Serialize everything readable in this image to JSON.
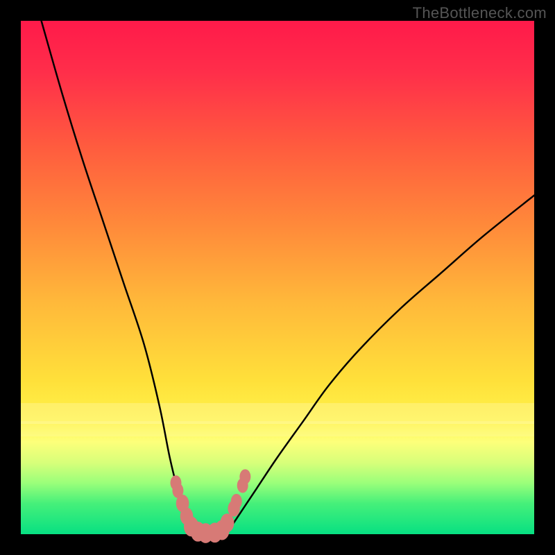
{
  "attribution": "TheBottleneck.com",
  "colors": {
    "gradient_top": "#ff1a4a",
    "gradient_mid": "#ffe03a",
    "gradient_bottom": "#07e082",
    "curve": "#000000",
    "markers": "#d77a76",
    "frame": "#000000"
  },
  "chart_data": {
    "type": "line",
    "title": "",
    "xlabel": "",
    "ylabel": "",
    "xlim": [
      0,
      100
    ],
    "ylim": [
      0,
      100
    ],
    "grid": false,
    "legend": false,
    "notes": "V-shaped bottleneck curve over gradient background. Minimum reaches 0 around x=33–40. Lower y = better (green band at bottom).",
    "series": [
      {
        "name": "left-branch",
        "x": [
          4,
          8,
          12,
          16,
          20,
          24,
          27,
          29,
          30.5,
          32,
          33,
          34
        ],
        "values": [
          100,
          86,
          73,
          61,
          49,
          37,
          25,
          15,
          9,
          5,
          2,
          0
        ]
      },
      {
        "name": "right-branch",
        "x": [
          40,
          42,
          44,
          46,
          50,
          55,
          60,
          66,
          74,
          82,
          90,
          100
        ],
        "values": [
          0,
          3,
          6,
          9,
          15,
          22,
          29,
          36,
          44,
          51,
          58,
          66
        ]
      },
      {
        "name": "valley-floor",
        "x": [
          34,
          36,
          38,
          40
        ],
        "values": [
          0,
          0,
          0,
          0
        ]
      }
    ],
    "markers": [
      {
        "x": 30.2,
        "y": 10,
        "r": 1.2
      },
      {
        "x": 30.6,
        "y": 8.5,
        "r": 1.2
      },
      {
        "x": 31.5,
        "y": 6,
        "r": 1.4
      },
      {
        "x": 32.3,
        "y": 3.5,
        "r": 1.4
      },
      {
        "x": 33.2,
        "y": 1.5,
        "r": 1.6
      },
      {
        "x": 34.5,
        "y": 0.5,
        "r": 1.6
      },
      {
        "x": 36,
        "y": 0.2,
        "r": 1.6
      },
      {
        "x": 37.8,
        "y": 0.3,
        "r": 1.6
      },
      {
        "x": 39.2,
        "y": 0.8,
        "r": 1.6
      },
      {
        "x": 40.2,
        "y": 2.2,
        "r": 1.5
      },
      {
        "x": 41.5,
        "y": 5,
        "r": 1.3
      },
      {
        "x": 42,
        "y": 6.4,
        "r": 1.2
      },
      {
        "x": 43.2,
        "y": 9.5,
        "r": 1.2
      },
      {
        "x": 43.7,
        "y": 11.2,
        "r": 1.2
      }
    ]
  }
}
